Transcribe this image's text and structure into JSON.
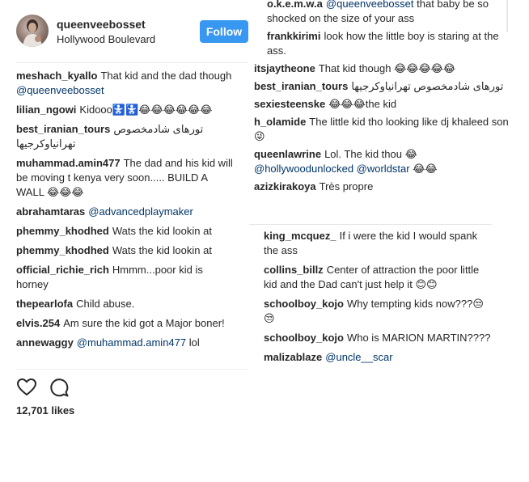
{
  "post": {
    "username": "queenveebosset",
    "location": "Hollywood Boulevard",
    "follow_label": "Follow",
    "likes": "12,701 likes"
  },
  "left_comments": [
    {
      "user": "meshach_kyallo",
      "text": "That kid and the dad though",
      "mention": "@queenveebosset",
      "after": ""
    },
    {
      "user": "lilian_ngowi",
      "text": "Kidooo🚼🚼😂😂😂😂😂😂",
      "mention": "",
      "after": ""
    },
    {
      "user": "best_iranian_tours",
      "text": "تورهای شادمخصوص تهرانیاوکرجیها",
      "mention": "",
      "after": ""
    },
    {
      "user": "muhammad.amin477",
      "text": "The dad and his kid will be moving t kenya very soon..... BUILD A WALL 😂😂😂",
      "mention": "",
      "after": ""
    },
    {
      "user": "abrahamtaras",
      "text": "",
      "mention": "@advancedplaymaker",
      "after": ""
    },
    {
      "user": "phemmy_khodhed",
      "text": "Wats the kid lookin at",
      "mention": "",
      "after": ""
    },
    {
      "user": "phemmy_khodhed",
      "text": "Wats the kid lookin at",
      "mention": "",
      "after": ""
    },
    {
      "user": "official_richie_rich",
      "text": "Hmmm...poor kid is horney",
      "mention": "",
      "after": ""
    },
    {
      "user": "thepearlofa",
      "text": "Child abuse.",
      "mention": "",
      "after": ""
    },
    {
      "user": "elvis.254",
      "text": "Am sure the kid got a Major boner!",
      "mention": "",
      "after": ""
    },
    {
      "user": "annewaggy",
      "text": "",
      "mention": "@muhammad.amin477",
      "after": "lol"
    }
  ],
  "right_top_comments": [
    {
      "user": "o.k.e.m.w.a",
      "text": "",
      "mention": "@queenveebosset",
      "after": "that baby be so shocked on the size of your ass",
      "indent": true
    },
    {
      "user": "frankkirimi",
      "text": "look how the little boy is staring at the ass.",
      "mention": "",
      "after": "",
      "indent": true
    },
    {
      "user": "itsjaytheone",
      "text": "That kid though 😂😂😂😂😂",
      "mention": "",
      "after": "",
      "indent": false
    },
    {
      "user": "best_iranian_tours",
      "text": "تورهای شادمخصوص تهرانیاوکرجیها",
      "mention": "",
      "after": "",
      "indent": false
    },
    {
      "user": "sexiesteenske",
      "text": "😂😂😂the kid",
      "mention": "",
      "after": "",
      "indent": false
    },
    {
      "user": "h_olamide",
      "text": "The little kid tho looking like dj khaleed son 😜",
      "mention": "",
      "after": "",
      "indent": false
    },
    {
      "user": "queenlawrine",
      "text": "Lol. The kid thou 😂",
      "mention": "@hollywoodunlocked @worldstar",
      "after": "😂😂",
      "indent": false
    },
    {
      "user": "azizkirakoya",
      "text": "Très propre",
      "mention": "",
      "after": "",
      "indent": false
    }
  ],
  "right_bottom_comments": [
    {
      "user": "king_mcquez_",
      "text": "If i were the kid I would spank the ass",
      "mention": "",
      "after": ""
    },
    {
      "user": "collins_billz",
      "text": "Center of attraction the poor little kid and the Dad can't just help it 😊😊",
      "mention": "",
      "after": ""
    },
    {
      "user": "schoolboy_kojo",
      "text": "Why tempting kids now???😒😒",
      "mention": "",
      "after": ""
    },
    {
      "user": "schoolboy_kojo",
      "text": "Who is MARION MARTIN????",
      "mention": "",
      "after": ""
    },
    {
      "user": "malizablaze",
      "text": "",
      "mention": "@uncle__scar",
      "after": ""
    }
  ],
  "icons": {
    "like": "heart-icon",
    "comment": "speech-bubble-icon"
  },
  "colors": {
    "follow_button": "#3897f0",
    "mention": "#003569",
    "text": "#262626"
  }
}
